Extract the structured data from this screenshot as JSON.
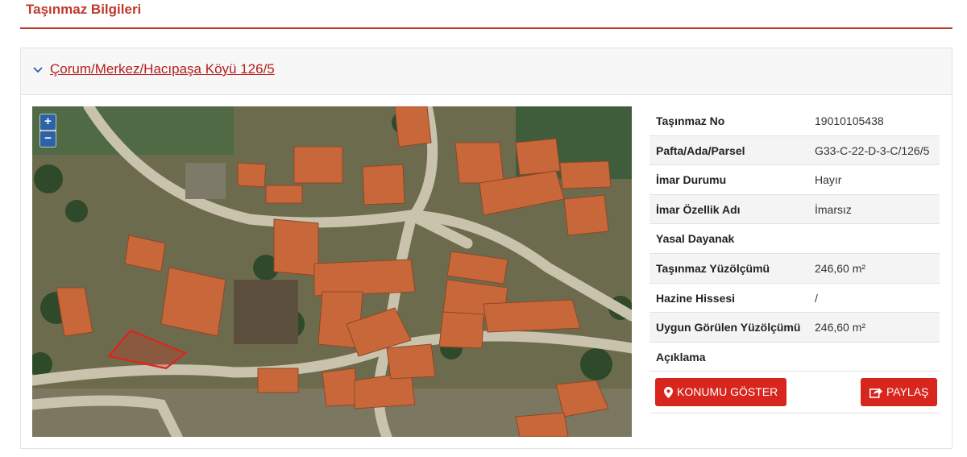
{
  "page_title": "Taşınmaz Bilgileri",
  "panel": {
    "title": "Çorum/Merkez/Hacıpaşa Köyü 126/5"
  },
  "map": {
    "zoom_in": "+",
    "zoom_out": "−",
    "parcel_color": "#e0231b"
  },
  "info_rows": [
    {
      "label": "Taşınmaz No",
      "value": "19010105438"
    },
    {
      "label": "Pafta/Ada/Parsel",
      "value": "G33-C-22-D-3-C/126/5"
    },
    {
      "label": "İmar Durumu",
      "value": "Hayır"
    },
    {
      "label": "İmar Özellik Adı",
      "value": "İmarsız"
    },
    {
      "label": "Yasal Dayanak",
      "value": ""
    },
    {
      "label": "Taşınmaz Yüzölçümü",
      "value": "246,60 m²"
    },
    {
      "label": "Hazine Hissesi",
      "value": "/"
    },
    {
      "label": "Uygun Görülen Yüzölçümü",
      "value": "246,60 m²"
    },
    {
      "label": "Açıklama",
      "value": ""
    }
  ],
  "buttons": {
    "show_location": "KONUMU GÖSTER",
    "share": "PAYLAŞ"
  },
  "colors": {
    "accent": "#c0392b",
    "button": "#d8261e",
    "map_control": "#2b62a8"
  }
}
